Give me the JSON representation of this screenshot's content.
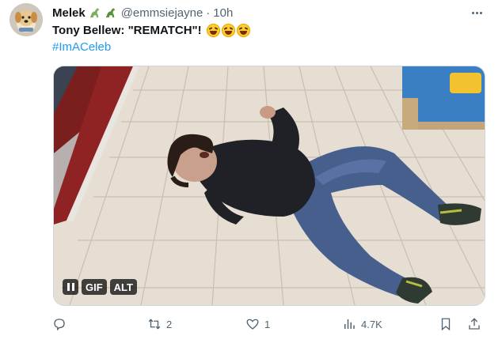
{
  "author": {
    "name": "Melek",
    "handle": "@emmsiejayne",
    "separator": "·",
    "time": "10h"
  },
  "tweet": {
    "text": "Tony Bellew: \"REMATCH\"!",
    "hashtag": "#ImACeleb"
  },
  "media": {
    "badge_gif": "GIF",
    "badge_alt": "ALT"
  },
  "actions": {
    "retweets": "2",
    "likes": "1",
    "views": "4.7K"
  },
  "colors": {
    "link": "#1d9bf0",
    "secondary_text": "#536471"
  },
  "icons": [
    "dinosaur-icon",
    "rolling-laughing-emoji",
    "reply-icon",
    "retweet-icon",
    "like-icon",
    "views-icon",
    "bookmark-icon",
    "share-icon",
    "more-icon",
    "pause-icon"
  ]
}
